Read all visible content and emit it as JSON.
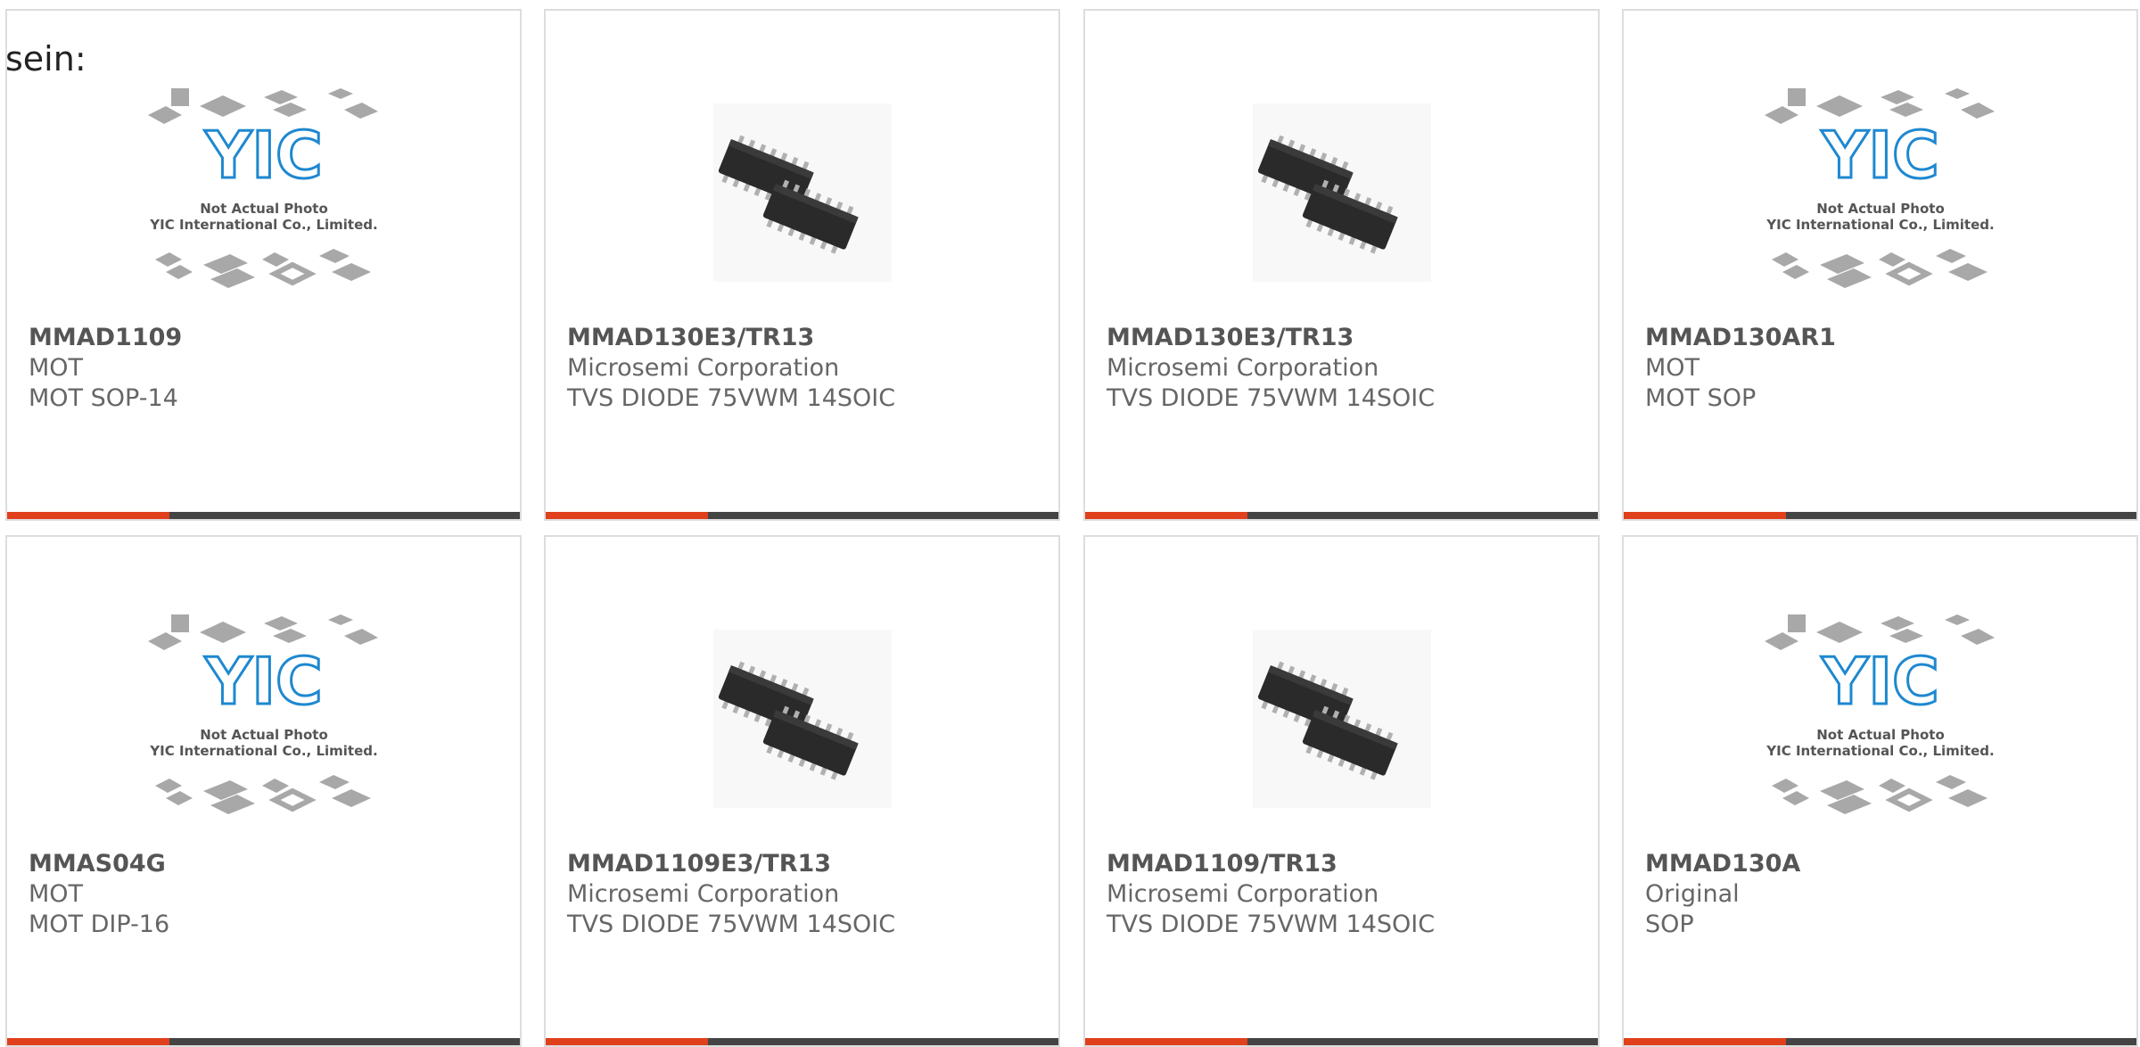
{
  "lead_text": "sein:",
  "colors": {
    "accent": "#e0401c",
    "bar": "#444444",
    "border": "#dddddd",
    "logo": "#1e88d0"
  },
  "placeholder": {
    "line1": "Not Actual Photo",
    "line2": "YIC International Co., Limited.",
    "logo_text": "YIC"
  },
  "products": [
    {
      "part_number": "MMAD1109",
      "manufacturer": "MOT",
      "description": "MOT SOP-14",
      "image": "placeholder"
    },
    {
      "part_number": "MMAD130E3/TR13",
      "manufacturer": "Microsemi Corporation",
      "description": "TVS DIODE 75VWM 14SOIC",
      "image": "soic-chip"
    },
    {
      "part_number": "MMAD130E3/TR13",
      "manufacturer": "Microsemi Corporation",
      "description": "TVS DIODE 75VWM 14SOIC",
      "image": "soic-chip"
    },
    {
      "part_number": "MMAD130AR1",
      "manufacturer": "MOT",
      "description": "MOT SOP",
      "image": "placeholder"
    },
    {
      "part_number": "MMAS04G",
      "manufacturer": "MOT",
      "description": "MOT DIP-16",
      "image": "placeholder"
    },
    {
      "part_number": "MMAD1109E3/TR13",
      "manufacturer": "Microsemi Corporation",
      "description": "TVS DIODE 75VWM 14SOIC",
      "image": "soic-chip"
    },
    {
      "part_number": "MMAD1109/TR13",
      "manufacturer": "Microsemi Corporation",
      "description": "TVS DIODE 75VWM 14SOIC",
      "image": "soic-chip"
    },
    {
      "part_number": "MMAD130A",
      "manufacturer": "Original",
      "description": "SOP",
      "image": "placeholder"
    }
  ]
}
